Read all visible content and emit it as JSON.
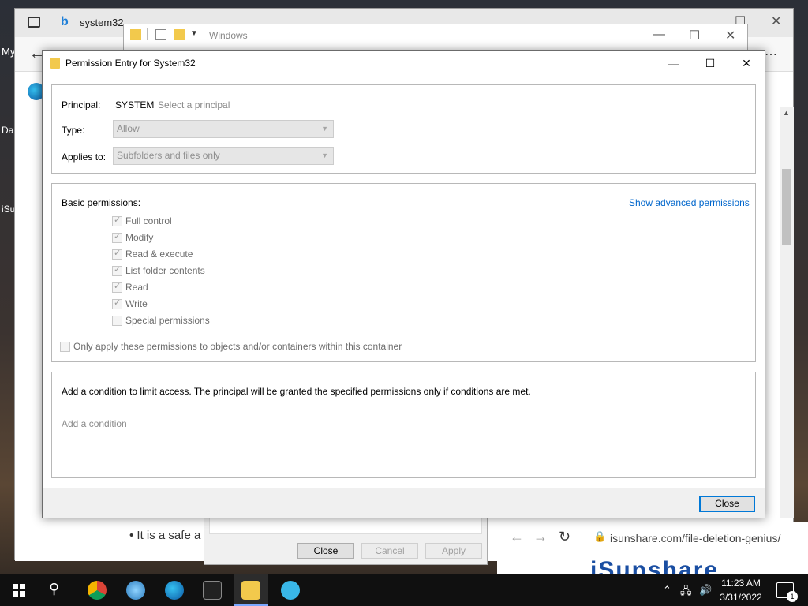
{
  "desktop": {
    "labels": [
      "My",
      "Da",
      "iSu\nDe"
    ]
  },
  "browser": {
    "tab_title": "system32",
    "address_url": "isunshare.com/file-deletion-genius/",
    "logo_text": "iSunshare",
    "bullet_text": "• It is a safe a"
  },
  "explorer": {
    "title": "Windows"
  },
  "properties_dialog": {
    "close_label": "Close",
    "cancel_label": "Cancel",
    "apply_label": "Apply"
  },
  "dialog": {
    "title": "Permission Entry for System32",
    "principal_label": "Principal:",
    "principal_value": "SYSTEM",
    "select_principal_link": "Select a principal",
    "type_label": "Type:",
    "type_value": "Allow",
    "applies_label": "Applies to:",
    "applies_value": "Subfolders and files only",
    "basic_perms_label": "Basic permissions:",
    "advanced_link": "Show advanced permissions",
    "permissions": [
      {
        "label": "Full control",
        "checked": true
      },
      {
        "label": "Modify",
        "checked": true
      },
      {
        "label": "Read & execute",
        "checked": true
      },
      {
        "label": "List folder contents",
        "checked": true
      },
      {
        "label": "Read",
        "checked": true
      },
      {
        "label": "Write",
        "checked": true
      },
      {
        "label": "Special permissions",
        "checked": false
      }
    ],
    "only_apply_label": "Only apply these permissions to objects and/or containers within this container",
    "condition_text": "Add a condition to limit access. The principal will be granted the specified permissions only if conditions are met.",
    "add_condition_link": "Add a condition",
    "close_button": "Close"
  },
  "taskbar": {
    "time": "11:23 AM",
    "date": "3/31/2022",
    "notification_count": "1"
  },
  "colors": {
    "accent": "#0078d7",
    "link": "#0066cc"
  }
}
